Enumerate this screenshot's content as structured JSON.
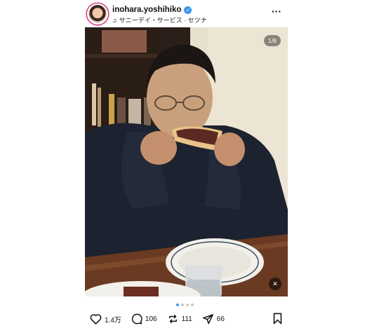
{
  "header": {
    "username": "inohara.yoshihiko",
    "song": "サニーデイ・サービス · セツナ"
  },
  "photo": {
    "counter": "1/8"
  },
  "actions": {
    "likes": "1.4万",
    "comments": "106",
    "reposts": "111",
    "shares": "66"
  },
  "carousel": {
    "total": 4,
    "active": 1
  },
  "colors": {
    "verified": "#3897f0",
    "active_dot": "#3897f0",
    "avatar_ring": "#d62976"
  },
  "icons": {
    "verified": "verified-badge-icon",
    "music": "music-note-icon",
    "more": "more-options-icon",
    "like": "heart-icon",
    "comment": "comment-icon",
    "repost": "repost-icon",
    "share": "send-icon",
    "save": "bookmark-icon",
    "mute": "mute-icon"
  }
}
